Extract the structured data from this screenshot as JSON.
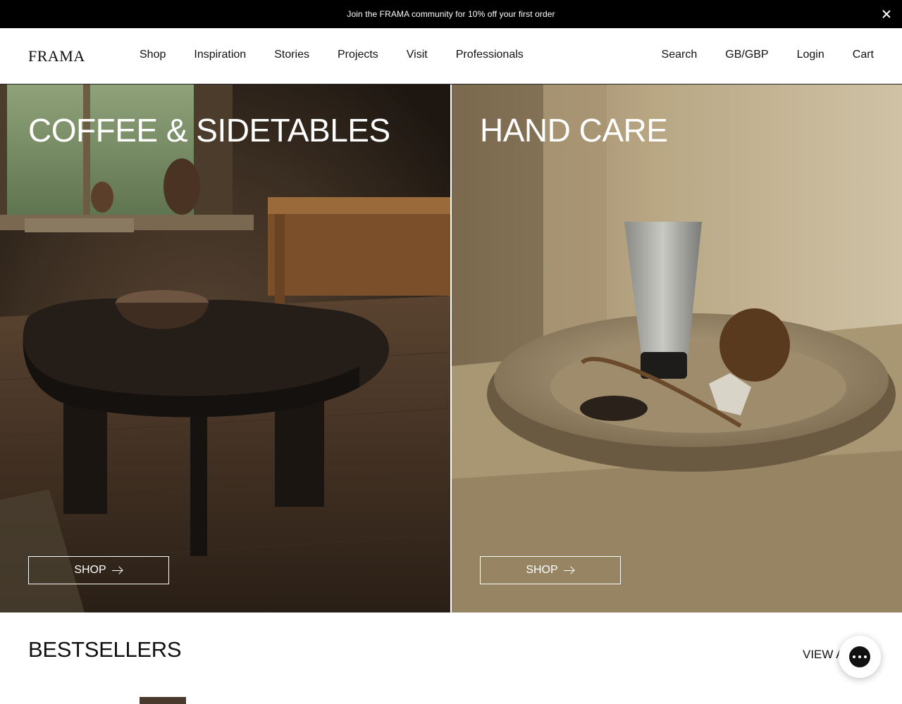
{
  "announcement": {
    "text": "Join the FRAMA community for 10% off your first order",
    "close_icon": "close-icon"
  },
  "header": {
    "logo": "FRAMA",
    "nav": [
      "Shop",
      "Inspiration",
      "Stories",
      "Projects",
      "Visit",
      "Professionals"
    ],
    "utilities": {
      "search": "Search",
      "region": "GB/GBP",
      "login": "Login",
      "cart": "Cart"
    }
  },
  "hero": {
    "left": {
      "title": "COFFEE & SIDETABLES",
      "cta": "SHOP",
      "cta_icon": "arrow-right-icon"
    },
    "right": {
      "title": "HAND CARE",
      "cta": "SHOP",
      "cta_icon": "arrow-right-icon"
    }
  },
  "bestsellers": {
    "title": "BESTSELLERS",
    "view_all": "VIEW A"
  },
  "chat": {
    "icon": "chat-icon"
  },
  "colors": {
    "announcement_bg": "#000000",
    "text": "#111111",
    "hero_left_tone": "#2b2219",
    "hero_right_tone": "#9b8a6c"
  }
}
